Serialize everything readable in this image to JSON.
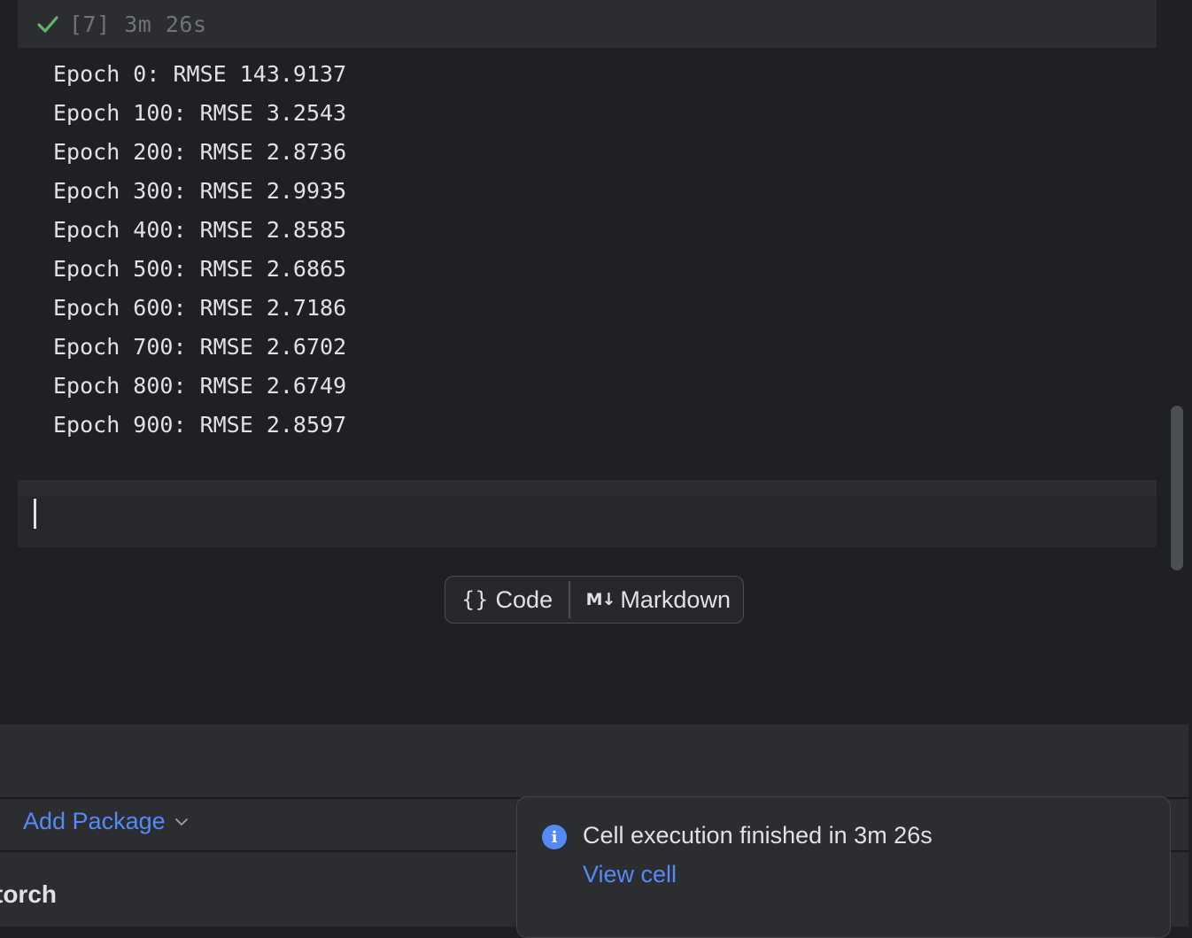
{
  "cell": {
    "execution_label": "[7] 3m 26s",
    "status_icon": "check-icon",
    "status_color": "#5fb865"
  },
  "output": {
    "lines": [
      "Epoch 0: RMSE 143.9137",
      "Epoch 100: RMSE 3.2543",
      "Epoch 200: RMSE 2.8736",
      "Epoch 300: RMSE 2.9935",
      "Epoch 400: RMSE 2.8585",
      "Epoch 500: RMSE 2.6865",
      "Epoch 600: RMSE 2.7186",
      "Epoch 700: RMSE 2.6702",
      "Epoch 800: RMSE 2.6749",
      "Epoch 900: RMSE 2.8597"
    ]
  },
  "add_cell_toolbar": {
    "code_icon": "{}",
    "code_label": "Code",
    "markdown_icon": "M↓",
    "markdown_label": "Markdown"
  },
  "packages_panel": {
    "add_package_label": "Add Package",
    "package_name": "torch"
  },
  "notification": {
    "icon": "info-icon",
    "message": "Cell execution finished in 3m 26s",
    "link_label": "View cell"
  },
  "colors": {
    "background": "#1f2024",
    "panel": "#2b2d30",
    "link": "#548af7",
    "text": "#dfe1e5"
  }
}
